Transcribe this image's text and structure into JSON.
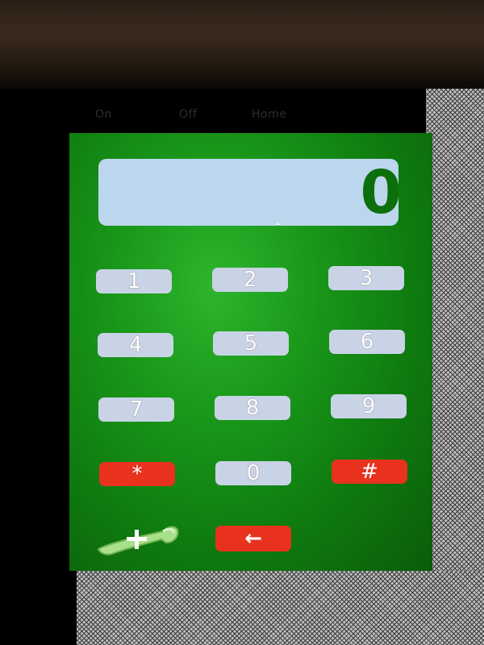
{
  "menu": {
    "on_label": "On",
    "off_label": "Off",
    "home_label": "Home"
  },
  "display": {
    "value": "0"
  },
  "keypad": {
    "k1": "1",
    "k2": "2",
    "k3": "3",
    "k4": "4",
    "k5": "5",
    "k6": "6",
    "k7": "7",
    "k8": "8",
    "k9": "9",
    "star": "*",
    "k0": "0",
    "hash": "#",
    "back": "←"
  },
  "icons": {
    "call": "phone-handset-plus-icon",
    "cursor": "mouse-pointer-icon"
  },
  "colors": {
    "panel_green": "#1a9a1a",
    "display_bg": "#bcd6ee",
    "display_text": "#0c6f0c",
    "key_bg": "#c9d3e6",
    "key_red": "#e8321e"
  }
}
